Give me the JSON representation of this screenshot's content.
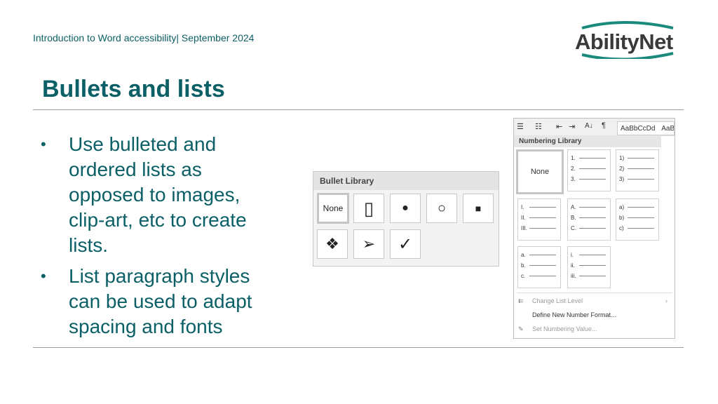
{
  "header": {
    "text": "Introduction to Word accessibility| September 2024"
  },
  "logo": {
    "text": "AbilityNet"
  },
  "slide": {
    "title": "Bullets and lists"
  },
  "bullets": [
    {
      "marker": "•",
      "text": "Use bulleted and ordered lists as opposed to images, clip-art, etc to create lists."
    },
    {
      "marker": "•",
      "text": "List paragraph styles can be used to adapt spacing and fonts"
    }
  ],
  "bullet_library": {
    "title": "Bullet Library",
    "none_label": "None",
    "symbols": [
      "▯",
      "●",
      "○",
      "■",
      "❖",
      "➢",
      "✓"
    ]
  },
  "numbering_library": {
    "toolbar_icons": [
      "bullets-icon",
      "multilevel-list-icon",
      "decrease-indent-icon",
      "increase-indent-icon",
      "sort-icon",
      "pilcrow-icon"
    ],
    "toolbar_pilcrow": "¶",
    "toolbar_sort": "A↓",
    "style_preview": "AaBbCcDd",
    "style_preview2": "AaB",
    "title": "Numbering Library",
    "none_label": "None",
    "formats": [
      [
        "1.",
        "2.",
        "3."
      ],
      [
        "1)",
        "2)",
        "3)"
      ],
      [
        "I.",
        "II.",
        "III."
      ],
      [
        "A.",
        "B.",
        "C."
      ],
      [
        "a)",
        "b)",
        "c)"
      ],
      [
        "a.",
        "b.",
        "c."
      ],
      [
        "i.",
        "ii.",
        "iii."
      ]
    ],
    "menu": [
      {
        "label": "Change List Level",
        "disabled": true,
        "arrow": "›"
      },
      {
        "label": "Define New Number Format...",
        "disabled": false
      },
      {
        "label": "Set Numbering Value...",
        "disabled": true
      }
    ]
  }
}
